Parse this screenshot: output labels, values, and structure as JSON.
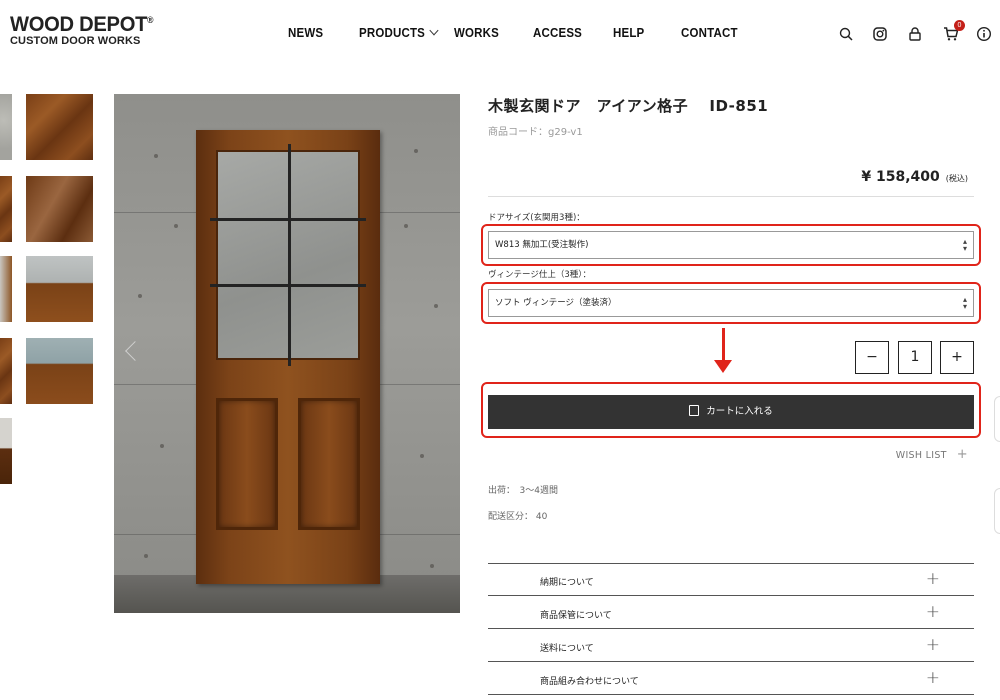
{
  "brand": {
    "line1": "WOOD DEPOT",
    "reg": "®",
    "line2": "CUSTOM DOOR WORKS"
  },
  "nav": {
    "news": "NEWS",
    "products": "PRODUCTS",
    "works": "WORKS",
    "access": "ACCESS",
    "help": "HELP",
    "contact": "CONTACT"
  },
  "header_icons": [
    "search-icon",
    "instagram-icon",
    "lock-icon",
    "cart-icon",
    "info-icon"
  ],
  "cart_count": "0",
  "product": {
    "title": "木製玄関ドア　アイアン格子　 ID-851",
    "code": "商品コード：g29-v1",
    "price": "¥ 158,400",
    "tax": "(税込)"
  },
  "options": {
    "size_label": "ドアサイズ(玄関用3種)：",
    "size_value": "W813 無加工(受注製作)",
    "finish_label": "ヴィンテージ仕上（3種）：",
    "finish_value": "ソフト ヴィンテージ（塗装済）"
  },
  "quantity": {
    "minus": "−",
    "value": "1",
    "plus": "+"
  },
  "cart_button": "カートに入れる",
  "wishlist": {
    "label": "WISH LIST",
    "plus": "+"
  },
  "shipping": {
    "lead_label": "出荷：",
    "lead_value": "3〜4週間",
    "class_label": "配送区分：",
    "class_value": "40"
  },
  "accordion": [
    {
      "title": "納期について",
      "icon": "+"
    },
    {
      "title": "商品保管について",
      "icon": "+"
    },
    {
      "title": "送料について",
      "icon": "+"
    },
    {
      "title": "商品組み合わせについて",
      "icon": "+"
    }
  ],
  "colors": {
    "highlight": "#e0241a",
    "cart_bg": "#333333",
    "badge": "#c42019"
  }
}
